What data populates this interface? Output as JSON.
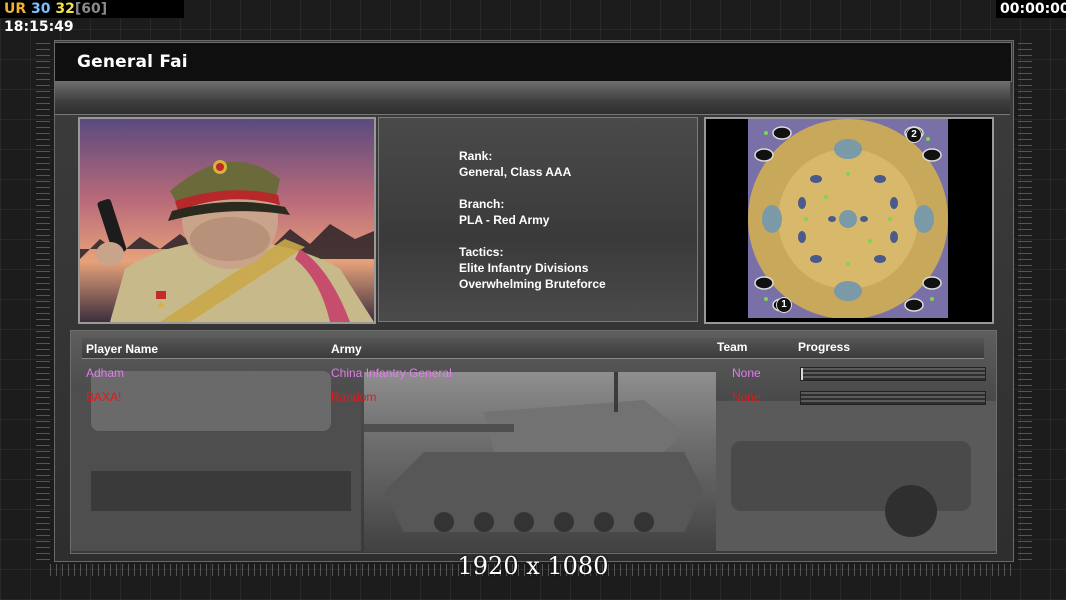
{
  "hud": {
    "ur": "UR",
    "n1": "30",
    "n2": "32",
    "n3": "[60]",
    "clock": "18:15:49",
    "timer": "00:00:00"
  },
  "title": "General Fai",
  "info": {
    "rank_label": "Rank:",
    "rank_value": "General, Class AAA",
    "branch_label": "Branch:",
    "branch_value": "PLA - Red Army",
    "tactics_label": "Tactics:",
    "tactics_1": "Elite Infantry Divisions",
    "tactics_2": "Overwhelming Bruteforce"
  },
  "map": {
    "markers": [
      "1",
      "2"
    ]
  },
  "table": {
    "headers": {
      "player": "Player Name",
      "army": "Army",
      "team": "Team",
      "progress": "Progress"
    },
    "rows": [
      {
        "name": "Adham",
        "army": "China Infantry General",
        "team": "None",
        "progress": 0.01,
        "color": "#e07de8"
      },
      {
        "name": "BAXA!",
        "army": "Random",
        "team": "None",
        "progress": 0,
        "color": "#e81818"
      }
    ]
  },
  "resolution": "1920 x 1080",
  "colors": {
    "player1": "#e07de8",
    "player2": "#e81818"
  }
}
